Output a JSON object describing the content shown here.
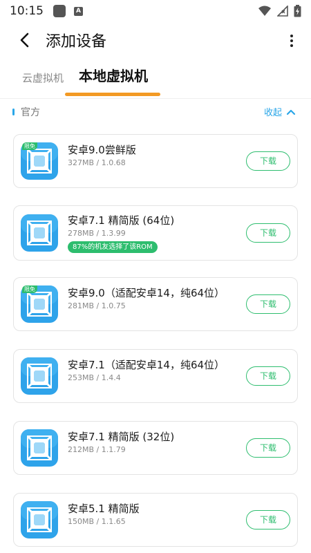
{
  "status_bar": {
    "time": "10:15",
    "a_badge": "A"
  },
  "header": {
    "title": "添加设备"
  },
  "tabs": [
    {
      "label": "云虚拟机",
      "active": false
    },
    {
      "label": "本地虚拟机",
      "active": true
    }
  ],
  "section": {
    "title": "官方",
    "collapse_label": "收起"
  },
  "colors": {
    "accent_blue": "#29a6e8",
    "accent_green": "#2dbd6e",
    "tab_indicator": "#f39a24"
  },
  "cards": [
    {
      "name": "安卓9.0尝鲜版",
      "meta": "327MB / 1.0.68",
      "corner_tag": "限免",
      "badge": "",
      "button": "下载"
    },
    {
      "name": "安卓7.1 精简版 (64位)",
      "meta": "278MB / 1.3.99",
      "corner_tag": "",
      "badge": "87%的机友选择了该ROM",
      "button": "下载"
    },
    {
      "name": "安卓9.0（适配安卓14，纯64位）",
      "meta": "281MB / 1.0.75",
      "corner_tag": "限免",
      "badge": "",
      "button": "下载"
    },
    {
      "name": "安卓7.1（适配安卓14，纯64位）",
      "meta": "253MB / 1.4.4",
      "corner_tag": "",
      "badge": "",
      "button": "下载"
    },
    {
      "name": "安卓7.1 精简版 (32位)",
      "meta": "212MB / 1.1.79",
      "corner_tag": "",
      "badge": "",
      "button": "下载"
    },
    {
      "name": "安卓5.1 精简版",
      "meta": "150MB / 1.1.65",
      "corner_tag": "",
      "badge": "",
      "button": "下载"
    }
  ]
}
